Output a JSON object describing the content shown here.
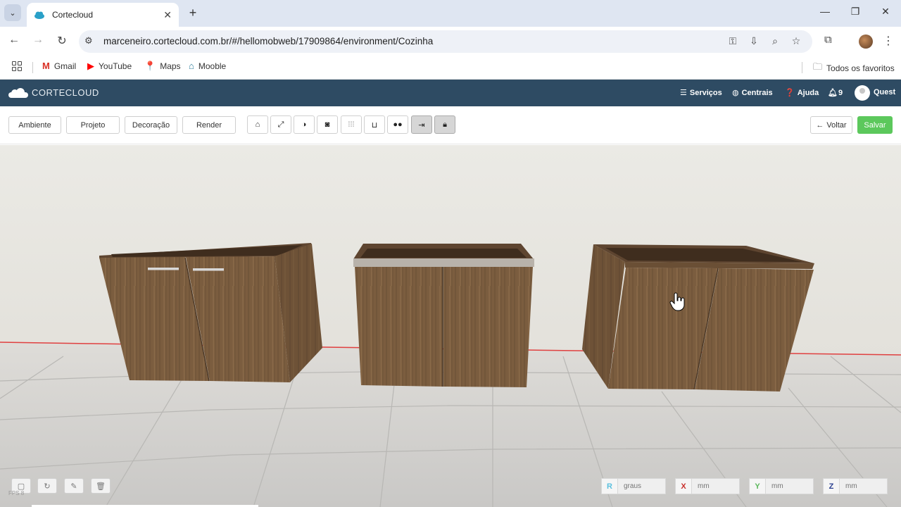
{
  "browser": {
    "tab_title": "Cortecloud",
    "tab_close": "✕",
    "new_tab": "+",
    "url": "marceneiro.cortecloud.com.br/#/hellomobweb/17909864/environment/Cozinha",
    "bookmarks": [
      {
        "label": "Gmail",
        "icon": "gmail-icon",
        "color": "#d93025"
      },
      {
        "label": "YouTube",
        "icon": "youtube-icon",
        "color": "#ff0000"
      },
      {
        "label": "Maps",
        "icon": "maps-icon",
        "color": "#34a853"
      },
      {
        "label": "Mooble",
        "icon": "mooble-icon",
        "color": "#2e7d9a"
      }
    ],
    "all_bookmarks": "Todos os favoritos"
  },
  "app": {
    "logo_text": "CORTECLOUD",
    "nav": {
      "servicos": "Serviços",
      "centrais": "Centrais",
      "ajuda": "Ajuda",
      "notifications": "9",
      "user": "Quest"
    },
    "header_color": "#2e4b63"
  },
  "toolbar": {
    "tabs": [
      "Ambiente",
      "Projeto",
      "Decoração",
      "Render"
    ],
    "icons": [
      "home-icon",
      "fullscreen-icon",
      "contrast-icon",
      "camera-icon",
      "grid-icon",
      "inbox-icon",
      "glasses-icon",
      "login-icon",
      "lock-icon"
    ],
    "voltar": "Voltar",
    "salvar": "Salvar",
    "salvar_color": "#5cc85c"
  },
  "scene": {
    "objects": [
      "cabinet-left",
      "cabinet-middle",
      "cabinet-right"
    ],
    "wood_color": "#7d5f40"
  },
  "bottom": {
    "fps": "FPS 8",
    "coords": [
      {
        "label": "R",
        "placeholder": "graus",
        "color": "#5bc0de"
      },
      {
        "label": "X",
        "placeholder": "mm",
        "color": "#c9302c"
      },
      {
        "label": "Y",
        "placeholder": "mm",
        "color": "#5cb85c"
      },
      {
        "label": "Z",
        "placeholder": "mm",
        "color": "#2a3f8f"
      }
    ]
  }
}
